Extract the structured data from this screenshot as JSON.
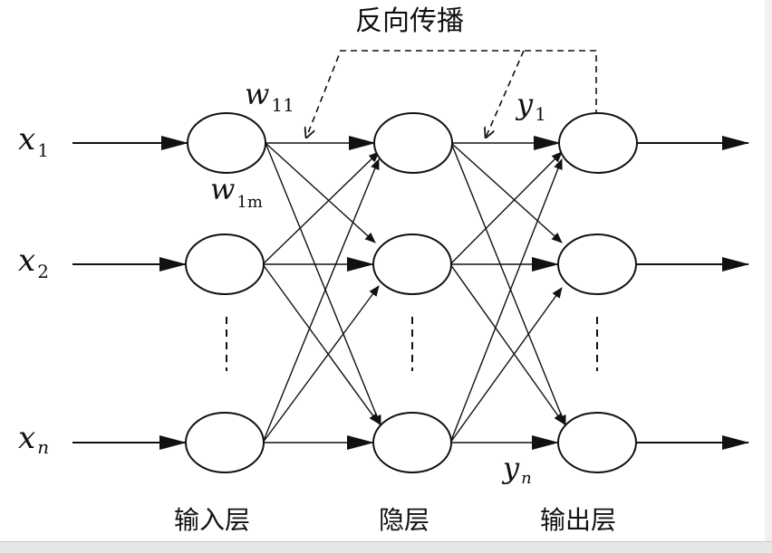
{
  "title": "反向传播",
  "inputs": [
    {
      "var": "x",
      "sub": "1"
    },
    {
      "var": "x",
      "sub": "2"
    },
    {
      "var": "x",
      "sub": "n"
    }
  ],
  "weights": {
    "w11": {
      "var": "w",
      "sub": "11"
    },
    "w1m": {
      "var": "w",
      "sub": "1m"
    }
  },
  "outputs": {
    "y1": {
      "var": "y",
      "sub": "1"
    },
    "yn": {
      "var": "y",
      "sub": "n"
    }
  },
  "layers": {
    "input": "输入层",
    "hidden": "隐层",
    "output": "输出层"
  },
  "colors": {
    "stroke": "#111111",
    "background": "#ffffff"
  }
}
